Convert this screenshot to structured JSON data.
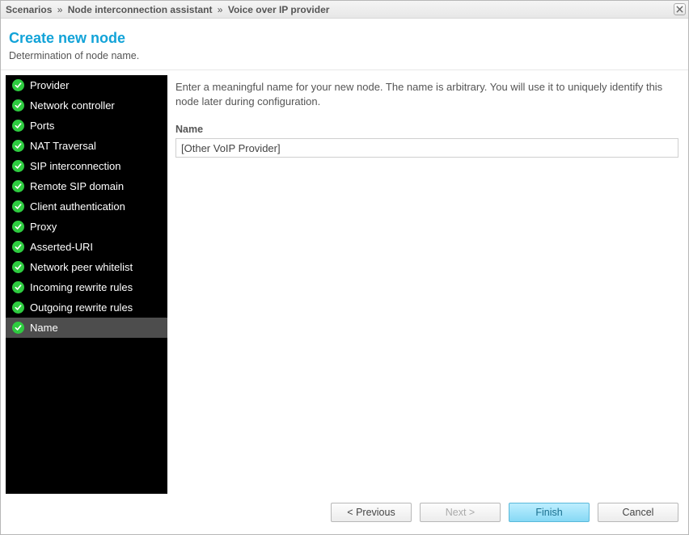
{
  "breadcrumb": [
    "Scenarios",
    "Node interconnection assistant",
    "Voice over IP provider"
  ],
  "header": {
    "title": "Create new node",
    "subtitle": "Determination of node name."
  },
  "steps": [
    {
      "label": "Provider",
      "done": true,
      "active": false
    },
    {
      "label": "Network controller",
      "done": true,
      "active": false
    },
    {
      "label": "Ports",
      "done": true,
      "active": false
    },
    {
      "label": "NAT Traversal",
      "done": true,
      "active": false
    },
    {
      "label": "SIP interconnection",
      "done": true,
      "active": false
    },
    {
      "label": "Remote SIP domain",
      "done": true,
      "active": false
    },
    {
      "label": "Client authentication",
      "done": true,
      "active": false
    },
    {
      "label": "Proxy",
      "done": true,
      "active": false
    },
    {
      "label": "Asserted-URI",
      "done": true,
      "active": false
    },
    {
      "label": "Network peer whitelist",
      "done": true,
      "active": false
    },
    {
      "label": "Incoming rewrite rules",
      "done": true,
      "active": false
    },
    {
      "label": "Outgoing rewrite rules",
      "done": true,
      "active": false
    },
    {
      "label": "Name",
      "done": true,
      "active": true
    }
  ],
  "content": {
    "description": "Enter a meaningful name for your new node. The name is arbitrary. You will use it to uniquely identify this node later during configuration.",
    "name_label": "Name",
    "name_value": "[Other VoIP Provider]"
  },
  "buttons": {
    "previous": "< Previous",
    "next": "Next >",
    "finish": "Finish",
    "cancel": "Cancel"
  }
}
